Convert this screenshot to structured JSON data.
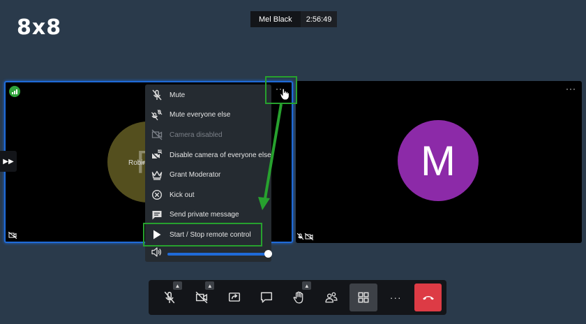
{
  "brand": {
    "logo_text": "8x8"
  },
  "meeting": {
    "participant_name": "Mel Black",
    "elapsed_time": "2:56:49"
  },
  "tiles": {
    "left": {
      "avatar_letter": "R",
      "name_fragment": "Robin",
      "signal_icon": "connection-signal-icon"
    },
    "right": {
      "avatar_letter": "M",
      "menu_dots": "···"
    }
  },
  "participant_menu": {
    "trigger_label": "···",
    "items": [
      {
        "label": "Mute",
        "icon": "mic-off-icon",
        "enabled": true
      },
      {
        "label": "Mute everyone else",
        "icon": "mute-everyone-icon",
        "enabled": true
      },
      {
        "label": "Camera disabled",
        "icon": "camera-off-icon",
        "enabled": false
      },
      {
        "label": "Disable camera of everyone else",
        "icon": "disable-cameras-icon",
        "enabled": true
      },
      {
        "label": "Grant Moderator",
        "icon": "crown-icon",
        "enabled": true
      },
      {
        "label": "Kick out",
        "icon": "kick-out-icon",
        "enabled": true
      },
      {
        "label": "Send private message",
        "icon": "chat-icon",
        "enabled": true
      },
      {
        "label": "Start / Stop remote control",
        "icon": "play-icon",
        "enabled": true
      }
    ],
    "volume": {
      "icon": "volume-icon",
      "level": 1.0
    }
  },
  "toolbar": {
    "buttons": [
      {
        "name": "mic-button",
        "icon": "mic-off-icon",
        "has_options": true
      },
      {
        "name": "camera-button",
        "icon": "camera-off-icon",
        "has_options": true
      },
      {
        "name": "screenshare-button",
        "icon": "screenshare-icon",
        "has_options": false
      },
      {
        "name": "chat-button",
        "icon": "chat-icon",
        "has_options": false
      },
      {
        "name": "raise-hand-button",
        "icon": "hand-icon",
        "has_options": true
      },
      {
        "name": "participants-button",
        "icon": "participants-icon",
        "has_options": false
      },
      {
        "name": "tile-view-button",
        "icon": "grid-icon",
        "has_options": false,
        "active": true
      },
      {
        "name": "more-button",
        "icon": "more-icon",
        "has_options": false
      },
      {
        "name": "hangup-button",
        "icon": "hangup-icon",
        "has_options": false
      }
    ],
    "more_label": "···"
  },
  "colors": {
    "background": "#2a3a4b",
    "active_speaker_border": "#1f6bd8",
    "annotation_green": "#27a12e",
    "hangup_red": "#dd3b45",
    "avatar_m": "#8c2aa8",
    "avatar_r": "#544f1e"
  }
}
